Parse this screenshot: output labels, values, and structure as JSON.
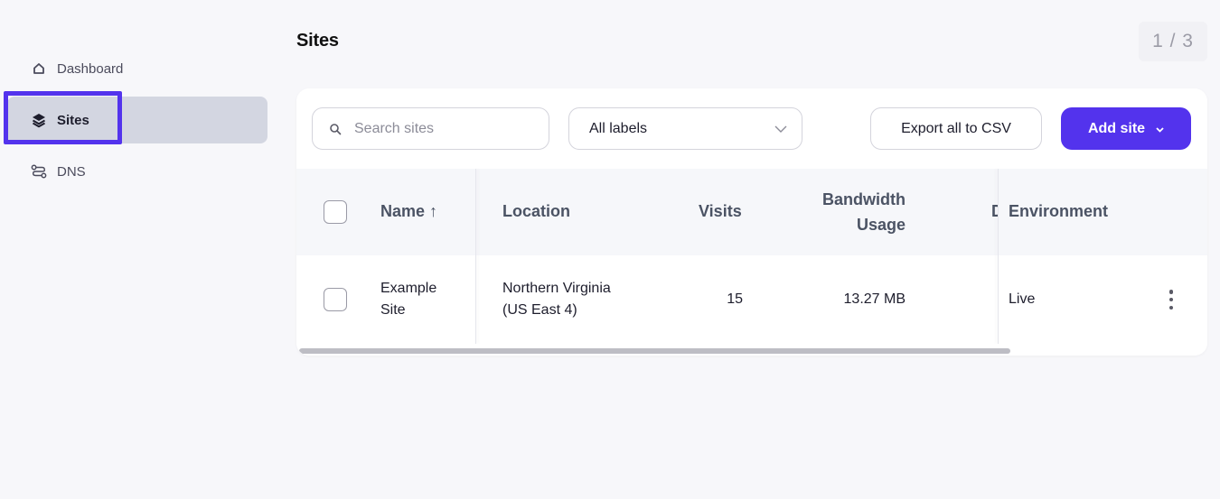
{
  "sidebar": {
    "items": [
      {
        "label": "Dashboard",
        "icon": "home-icon"
      },
      {
        "label": "Sites",
        "icon": "layers-icon",
        "active": true
      },
      {
        "label": "DNS",
        "icon": "dns-route-icon"
      }
    ]
  },
  "header": {
    "title": "Sites",
    "pager": "1 / 3"
  },
  "toolbar": {
    "search_placeholder": "Search sites",
    "labels_filter": "All labels",
    "export_label": "Export all to CSV",
    "add_label": "Add site"
  },
  "table": {
    "columns": {
      "name": "Name ↑",
      "location": "Location",
      "visits": "Visits",
      "bandwidth_line1": "Bandwidth",
      "bandwidth_line2": "Usage",
      "clipped": "D",
      "environment": "Environment"
    },
    "rows": [
      {
        "name_line1": "Example",
        "name_line2": "Site",
        "location_line1": "Northern Virginia",
        "location_line2": "(US East 4)",
        "visits": "15",
        "bandwidth": "13.27 MB",
        "environment": "Live"
      }
    ]
  },
  "colors": {
    "accent": "#5333ed",
    "active_nav_bg": "#d3d6e1",
    "page_bg": "#f7f7fa"
  }
}
